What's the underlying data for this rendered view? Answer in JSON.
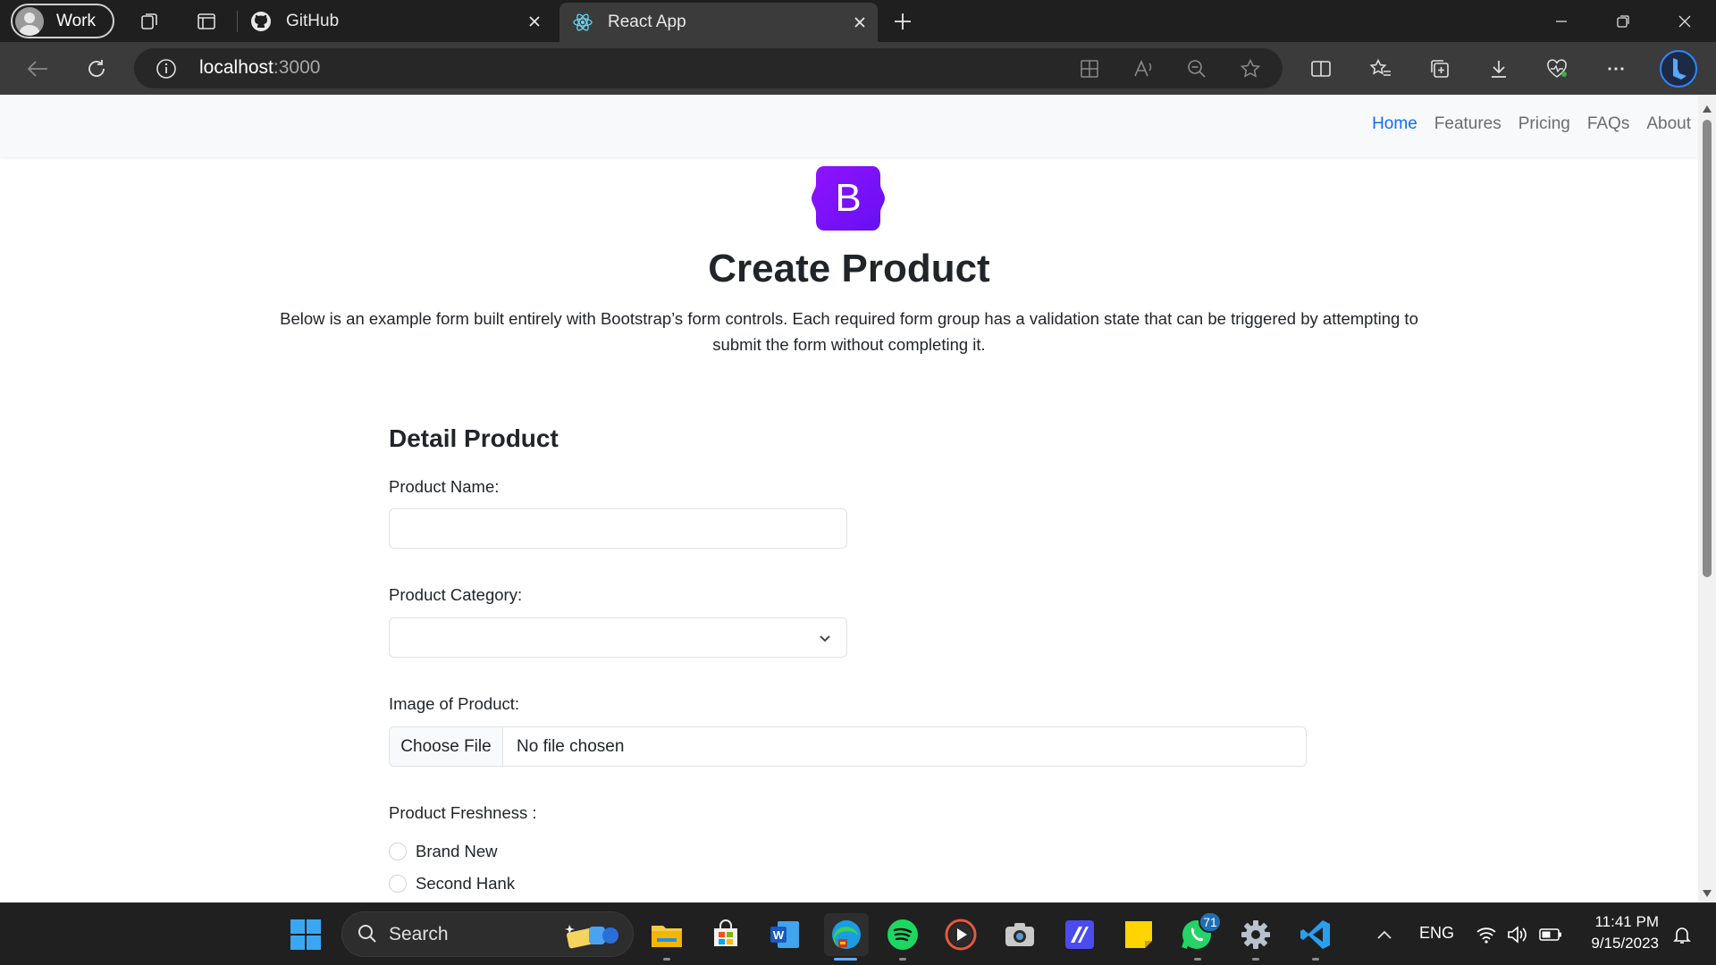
{
  "browser": {
    "profile_label": "Work",
    "tabs": [
      {
        "label": "GitHub",
        "active": false
      },
      {
        "label": "React App",
        "active": true
      }
    ],
    "url_host": "localhost",
    "url_port": ":3000"
  },
  "navbar": {
    "links": [
      {
        "label": "Home",
        "active": true
      },
      {
        "label": "Features",
        "active": false
      },
      {
        "label": "Pricing",
        "active": false
      },
      {
        "label": "FAQs",
        "active": false
      },
      {
        "label": "About",
        "active": false
      }
    ]
  },
  "hero": {
    "logo_letter": "B",
    "title": "Create Product",
    "lead": "Below is an example form built entirely with Bootstrap’s form controls. Each required form group has a validation state that can be triggered by attempting to submit the form without completing it."
  },
  "form": {
    "section_title": "Detail Product",
    "product_name_label": "Product Name:",
    "product_name_value": "",
    "product_category_label": "Product Category:",
    "product_category_value": "",
    "image_label": "Image of Product:",
    "choose_file_label": "Choose File",
    "no_file_label": "No file chosen",
    "freshness_label": "Product Freshness :",
    "freshness_options": [
      {
        "label": "Brand New",
        "checked": false
      },
      {
        "label": "Second Hank",
        "checked": false
      }
    ]
  },
  "taskbar": {
    "search_label": "Search",
    "whatsapp_badge": "71",
    "language": "ENG",
    "time": "11:41 PM",
    "date": "9/15/2023"
  },
  "colors": {
    "accent": "#0d6efd",
    "bootstrap_purple": "#7952b3",
    "browser_dark": "#1f1f1f",
    "taskbar_bg": "#202020"
  }
}
